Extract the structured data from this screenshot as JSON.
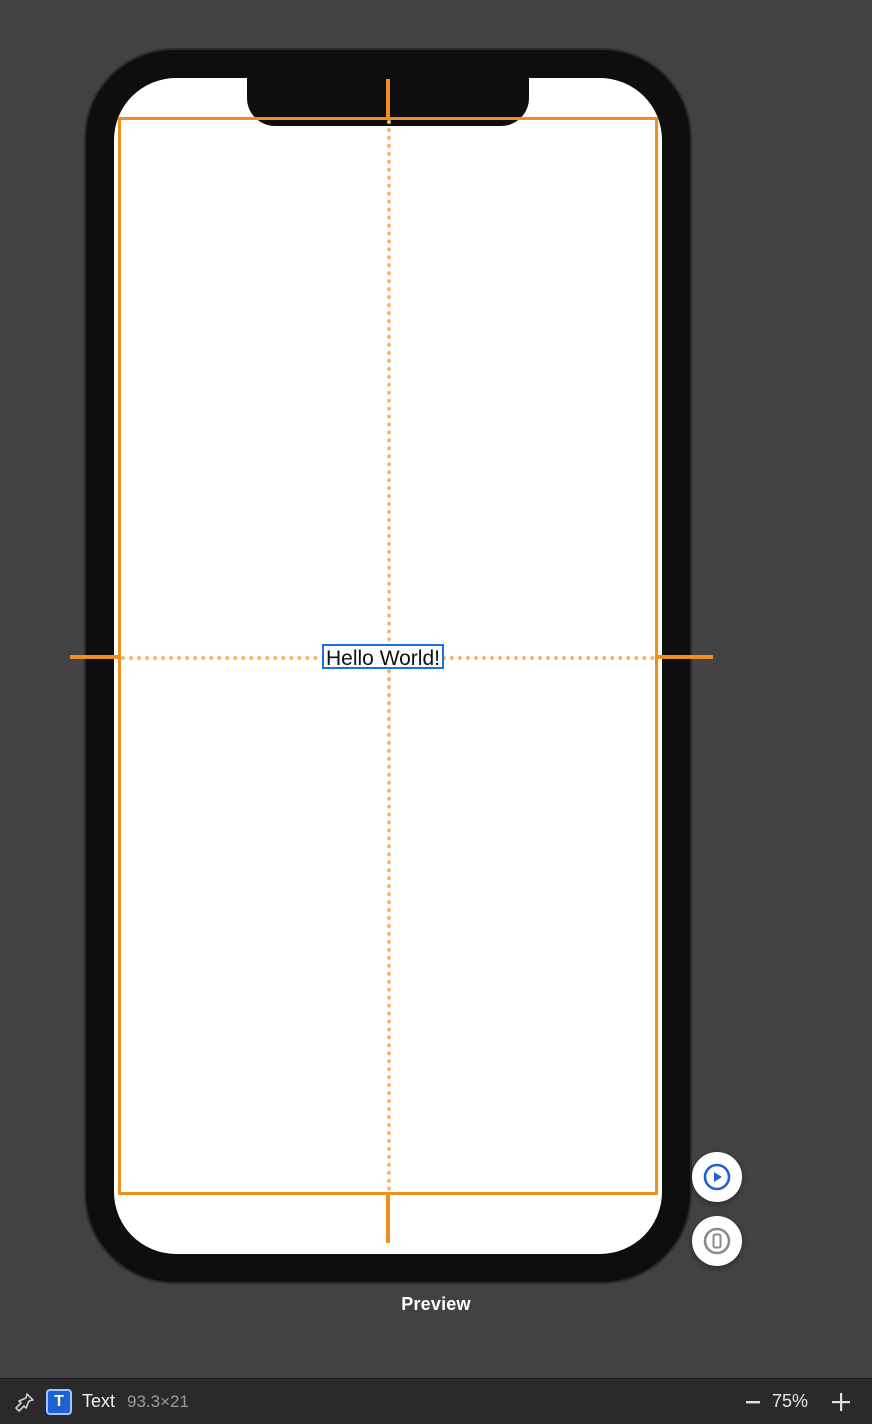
{
  "canvas": {
    "selected_text": "Hello World!",
    "preview_label": "Preview"
  },
  "fab": {
    "play_icon": "play-icon",
    "device_icon": "device-icon"
  },
  "statusbar": {
    "pin_icon": "pin-icon",
    "type_badge": "T",
    "element_name": "Text",
    "dimensions": "93.3×21",
    "zoom_minus": "−",
    "zoom_value": "75%",
    "plus_icon": "plus-icon"
  },
  "colors": {
    "guide": "#ee9021",
    "selection": "#1872e7",
    "accent_blue": "#1e62d0"
  }
}
